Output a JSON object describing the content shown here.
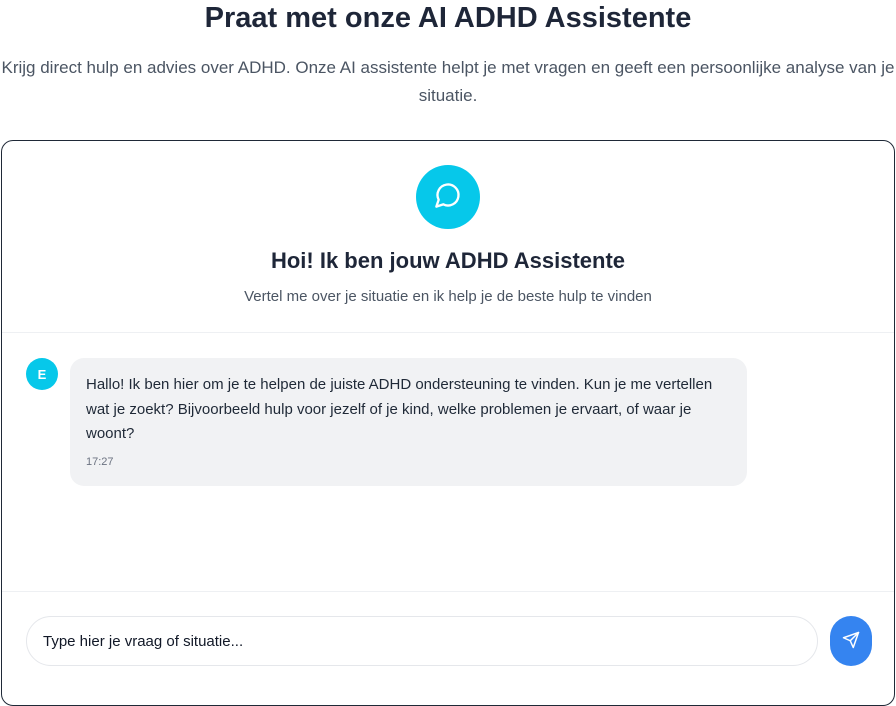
{
  "page": {
    "title": "Praat met onze AI ADHD Assistente",
    "subtitle": "Krijg direct hulp en advies over ADHD. Onze AI assistente helpt je met vragen en geeft een persoonlijke analyse van je situatie."
  },
  "chat": {
    "header": {
      "icon": "message-circle-icon",
      "title": "Hoi! Ik ben jouw ADHD Assistente",
      "subtitle": "Vertel me over je situatie en ik help je de beste hulp te vinden"
    },
    "messages": [
      {
        "avatar_letter": "E",
        "text": "Hallo! Ik ben hier om je te helpen de juiste ADHD ondersteuning te vinden. Kun je me vertellen wat je zoekt? Bijvoorbeeld hulp voor jezelf of je kind, welke problemen je ervaart, of waar je woont?",
        "time": "17:27"
      }
    ],
    "input": {
      "placeholder": "Type hier je vraag of situatie...",
      "value": ""
    },
    "send_icon": "send-icon"
  },
  "colors": {
    "accent": "#06c8ea",
    "send_button": "#3584f0",
    "bubble_bg": "#f1f2f4",
    "title_text": "#1e2638"
  }
}
